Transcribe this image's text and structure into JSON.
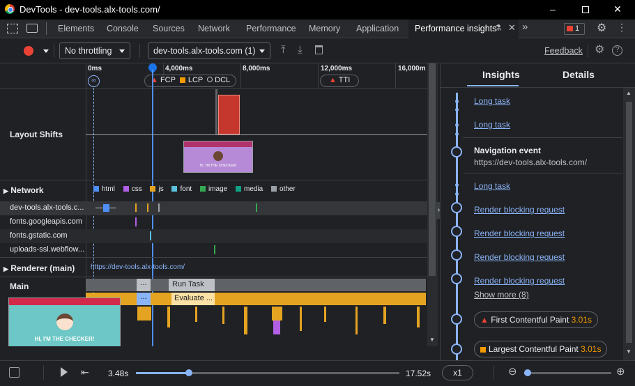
{
  "window": {
    "title": "DevTools - dev-tools.alx-tools.com/"
  },
  "tabs": [
    {
      "label": "Elements"
    },
    {
      "label": "Console"
    },
    {
      "label": "Sources"
    },
    {
      "label": "Network"
    },
    {
      "label": "Performance"
    },
    {
      "label": "Memory"
    },
    {
      "label": "Application"
    },
    {
      "label": "Performance insights"
    }
  ],
  "issues_count": "1",
  "toolbar": {
    "throttling": "No throttling",
    "recording": "dev-tools.alx-tools.com (1)",
    "feedback": "Feedback"
  },
  "ruler": {
    "t0": "0ms",
    "t1": "4,000ms",
    "t2": "8,000ms",
    "t3": "12,000ms",
    "t4": "16,000m"
  },
  "markers": {
    "fcp": "FCP",
    "lcp": "LCP",
    "dcl": "DCL",
    "tti": "TTI"
  },
  "tracks": {
    "layout_shifts": "Layout Shifts",
    "network": "Network",
    "renderer": "Renderer (main)",
    "renderer_url": "https://dev-tools.alx-tools.com/",
    "main": "Main",
    "run_task": "Run Task",
    "evaluate": "Evaluate ...",
    "ellipsis": "..."
  },
  "network_legend": [
    "html",
    "css",
    "js",
    "font",
    "image",
    "media",
    "other"
  ],
  "legend_colors": [
    "#4f8ff5",
    "#b15fe3",
    "#e4a321",
    "#5bc0de",
    "#34a853",
    "#12a085",
    "#9aa0a6"
  ],
  "network_rows": [
    "dev-tools.alx-tools.c...",
    "fonts.googleapis.com",
    "fonts.gstatic.com",
    "uploads-ssl.webflow..."
  ],
  "thumbnail": {
    "text": "HI, I'M THE CHECKER!",
    "small_text": "HI, I'M THE CHECKER!"
  },
  "side_tabs": {
    "insights": "Insights",
    "details": "Details"
  },
  "insights": {
    "long_task_1": "Long task",
    "long_task_2": "Long task",
    "nav_title": "Navigation event",
    "nav_url": "https://dev-tools.alx-tools.com/",
    "long_task_3": "Long task",
    "rbr_1": "Render blocking request",
    "rbr_2": "Render blocking request",
    "rbr_3": "Render blocking request",
    "rbr_4": "Render blocking request",
    "show_more": "Show more (8)",
    "fcp_label": "First Contentful Paint",
    "fcp_value": "3.01s",
    "lcp_label": "Largest Contentful Paint",
    "lcp_value": "3.01s"
  },
  "playback": {
    "current": "3.48s",
    "total": "17.52s",
    "speed": "x1",
    "progress": 0.2
  },
  "colors": {
    "accent": "#8ab4f8",
    "record": "#ea4335",
    "warning": "#f29900"
  }
}
